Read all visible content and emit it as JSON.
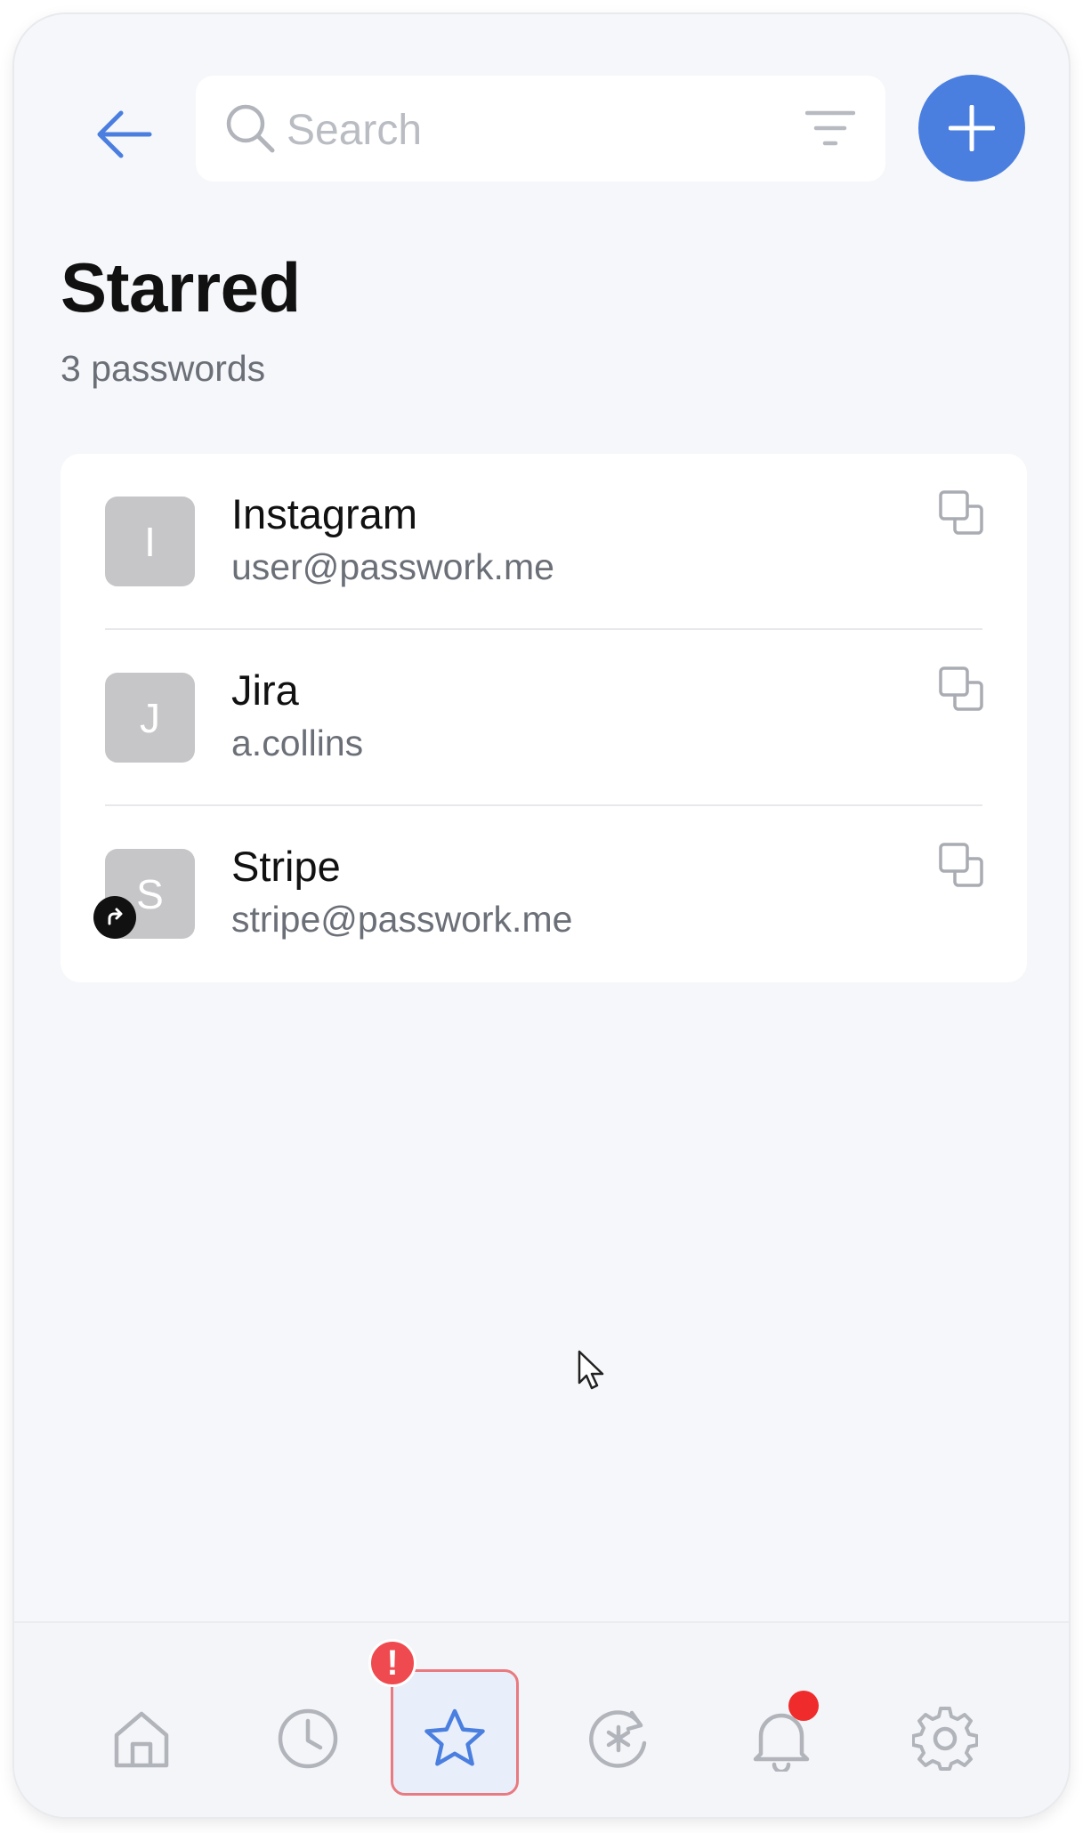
{
  "header": {
    "search_placeholder": "Search",
    "icons": {
      "back": "arrow-left-icon",
      "search": "search-icon",
      "filter": "filter-icon",
      "add": "plus-icon"
    },
    "accent_color": "#4a7fe0"
  },
  "page": {
    "title": "Starred",
    "subtitle": "3 passwords"
  },
  "items": [
    {
      "initial": "I",
      "title": "Instagram",
      "subtitle": "user@passwork.me",
      "shared": false
    },
    {
      "initial": "J",
      "title": "Jira",
      "subtitle": "a.collins",
      "shared": false
    },
    {
      "initial": "S",
      "title": "Stripe",
      "subtitle": "stripe@passwork.me",
      "shared": true
    }
  ],
  "nav": {
    "items": [
      "home-icon",
      "clock-icon",
      "star-icon",
      "password-generator-icon",
      "bell-icon",
      "gear-icon"
    ],
    "active": "star-icon",
    "warning_badge": "!",
    "notification_dot": true
  },
  "colors": {
    "avatar_bg": "#c6c6c8",
    "highlight_border": "#e87a80",
    "warning_badge": "#ef4a4f",
    "notification_dot": "#ef2b2b"
  }
}
